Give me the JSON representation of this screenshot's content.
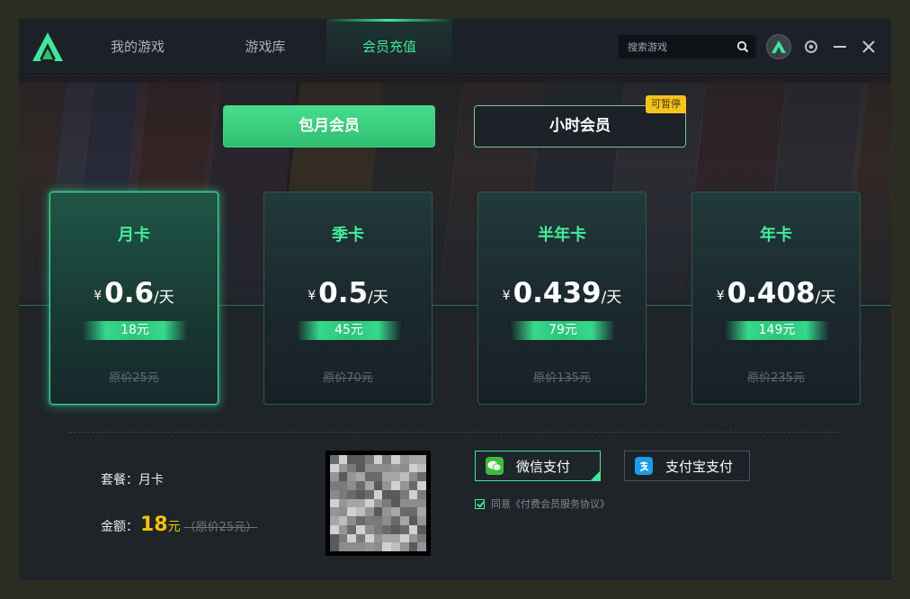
{
  "nav": {
    "tabs": [
      {
        "label": "我的游戏",
        "active": false
      },
      {
        "label": "游戏库",
        "active": false
      },
      {
        "label": "会员充值",
        "active": true
      }
    ],
    "search_placeholder": "搜索游戏",
    "icons": [
      "logo-icon",
      "search-icon",
      "avatar",
      "settings-icon",
      "minimize-icon",
      "close-icon"
    ]
  },
  "membership_type": {
    "monthly_label": "包月会员",
    "hourly_label": "小时会员",
    "hourly_badge": "可暂停",
    "selected": "monthly"
  },
  "plans": [
    {
      "name": "月卡",
      "currency": "¥",
      "per_day": "0.6",
      "unit": "/天",
      "total": "18元",
      "original": "原价25元",
      "selected": true
    },
    {
      "name": "季卡",
      "currency": "¥",
      "per_day": "0.5",
      "unit": "/天",
      "total": "45元",
      "original": "原价70元",
      "selected": false
    },
    {
      "name": "半年卡",
      "currency": "¥",
      "per_day": "0.439",
      "unit": "/天",
      "total": "79元",
      "original": "原价135元",
      "selected": false
    },
    {
      "name": "年卡",
      "currency": "¥",
      "per_day": "0.408",
      "unit": "/天",
      "total": "149元",
      "original": "原价235元",
      "selected": false
    }
  ],
  "summary": {
    "package_label": "套餐：",
    "package_value": "月卡",
    "amount_label": "金额：",
    "amount_value": "18",
    "amount_unit": "元",
    "amount_original": "（原价25元）"
  },
  "payment": {
    "wechat_label": "微信支付",
    "alipay_label": "支付宝支付",
    "selected": "wechat",
    "agree_text": "同意《付费会员服务协议》",
    "agree_checked": true
  },
  "colors": {
    "accent": "#3ee89b",
    "price_highlight": "#f5c400",
    "badge": "#f4c51b",
    "background": "#1f2429"
  }
}
